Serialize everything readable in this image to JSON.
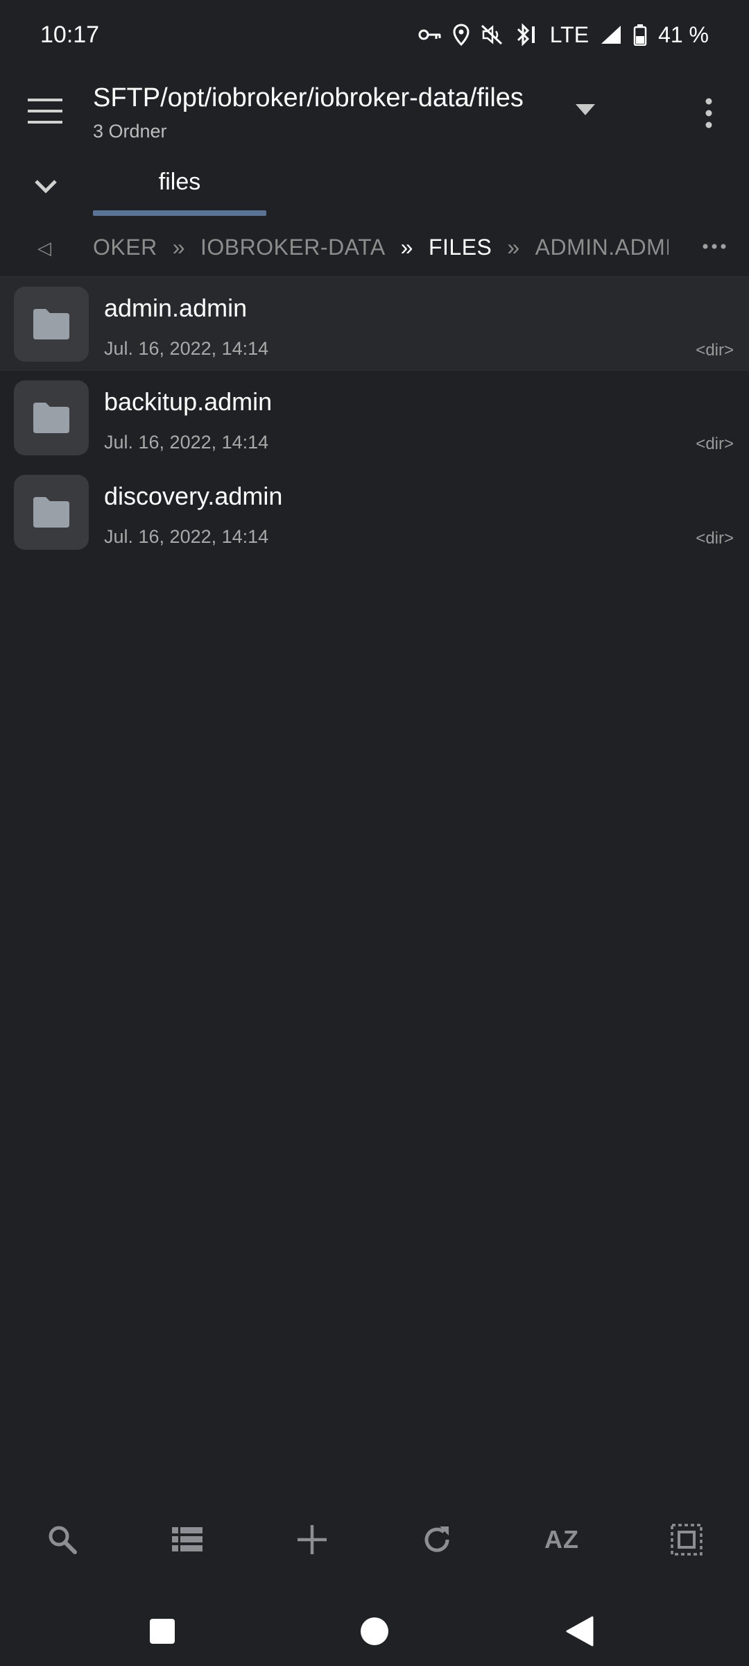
{
  "status_bar": {
    "time": "10:17",
    "network": "LTE",
    "battery": "41 %"
  },
  "toolbar": {
    "title": "SFTP/opt/iobroker/iobroker-data/files",
    "subtitle": "3 Ordner"
  },
  "tabs": [
    {
      "label": "files",
      "active": true
    }
  ],
  "breadcrumb": {
    "back_glyph": "◁",
    "segments": [
      "OKER",
      "IOBROKER-DATA",
      "FILES",
      "ADMIN.ADMIN"
    ],
    "separator": "»",
    "current_index": 2
  },
  "files": [
    {
      "name": "admin.admin",
      "date": "Jul. 16, 2022, 14:14",
      "type": "<dir>",
      "selected": true
    },
    {
      "name": "backitup.admin",
      "date": "Jul. 16, 2022, 14:14",
      "type": "<dir>",
      "selected": false
    },
    {
      "name": "discovery.admin",
      "date": "Jul. 16, 2022, 14:14",
      "type": "<dir>",
      "selected": false
    }
  ],
  "bottom_toolbar": {
    "sort_label": "AZ",
    "icons": [
      "search-icon",
      "list-view-icon",
      "add-icon",
      "refresh-icon",
      "sort-az-icon",
      "select-all-icon"
    ]
  },
  "colors": {
    "background": "#202124",
    "tab_indicator": "#5b7395",
    "icon_gray": "#8d8f94"
  }
}
